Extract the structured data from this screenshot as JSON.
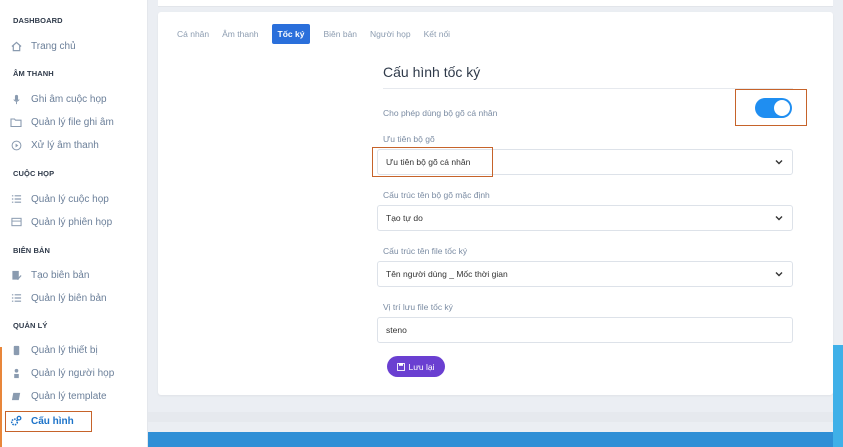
{
  "sidebar": {
    "sections": {
      "dashboard": "DASHBOARD",
      "audio": "ÂM THANH",
      "meeting": "CUỘC HỌP",
      "minutes": "BIÊN BẢN",
      "manage": "QUẢN LÝ"
    },
    "items": {
      "home": "Trang chủ",
      "record": "Ghi âm cuộc họp",
      "files": "Quản lý file ghi âm",
      "process": "Xử lý âm thanh",
      "meetings": "Quản lý cuộc họp",
      "sessions": "Quản lý phiên họp",
      "create_minutes": "Tạo biên bản",
      "manage_minutes": "Quản lý biên bản",
      "devices": "Quản lý thiết bị",
      "participants": "Quản lý người họp",
      "templates": "Quản lý template",
      "settings": "Cấu hình"
    }
  },
  "tabs": {
    "personal": "Cá nhân",
    "audio": "Âm thanh",
    "steno": "Tốc ký",
    "minutes": "Biên bản",
    "participants": "Người họp",
    "connect": "Kết nối"
  },
  "form": {
    "title": "Cấu hình tốc ký",
    "personal_label": "Cho phép dùng bộ gõ cá nhân",
    "personal_enabled": true,
    "priority_label": "Ưu tiên bộ gõ",
    "priority_value": "Ưu tiên bộ gõ cá nhân",
    "default_structure_label": "Cấu trúc tên bộ gõ mặc định",
    "default_structure_value": "Tạo tự do",
    "file_structure_label": "Cấu trúc tên file tốc ký",
    "file_structure_value": "Tên người dùng _ Mốc thời gian",
    "location_label": "Vị trí lưu file tốc ký",
    "location_value": "steno",
    "save_label": "Lưu lại"
  },
  "colors": {
    "active_tab": "#2a6fdb",
    "toggle_on": "#1f8ef1",
    "save_button": "#6a3fd1",
    "highlight_box": "#c6632a"
  }
}
